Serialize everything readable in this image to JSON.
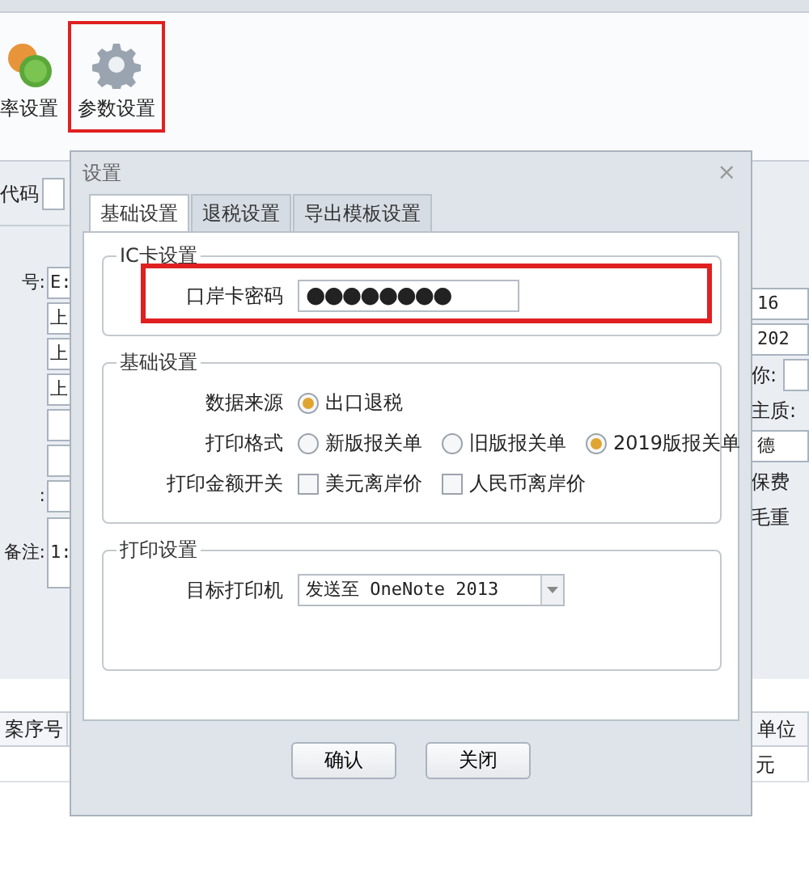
{
  "ribbon": {
    "buttons": [
      {
        "label": "率设置",
        "kind": "currency",
        "highlighted": false
      },
      {
        "label": "参数设置",
        "kind": "gear",
        "highlighted": true
      }
    ]
  },
  "left_panel": {
    "top_label": "代码",
    "rows": [
      {
        "label": "号:",
        "value": "E:"
      },
      {
        "value": "上"
      },
      {
        "value": "上"
      },
      {
        "value": "上"
      },
      {
        "kind": "field"
      },
      {
        "kind": "field"
      },
      {
        "label": ":"
      },
      {
        "label": "备注:",
        "value": "1:",
        "kind": "tall"
      }
    ]
  },
  "right_panel": {
    "rows": [
      {
        "kind": "field",
        "value": "16"
      },
      {
        "kind": "field",
        "value": "202"
      },
      {
        "kind": "label_field",
        "label": "你:"
      },
      {
        "kind": "label",
        "label": "主质:"
      },
      {
        "kind": "field",
        "value": "德"
      },
      {
        "kind": "label",
        "label": "保费"
      },
      {
        "kind": "label",
        "label": "毛重"
      }
    ]
  },
  "table": {
    "left_header": "案序号",
    "right_header": "单位",
    "right_cell": "元"
  },
  "dialog": {
    "title": "设置",
    "close": "×",
    "tabs": [
      {
        "label": "基础设置",
        "selected": true
      },
      {
        "label": "退税设置",
        "selected": false
      },
      {
        "label": "导出模板设置",
        "selected": false
      }
    ],
    "groups": [
      {
        "title": "IC卡设置",
        "highlighted": true,
        "rows": [
          {
            "label": "口岸卡密码",
            "kind": "password",
            "value": "●●●●●●●●"
          }
        ]
      },
      {
        "title": "基础设置",
        "highlighted": false,
        "rows": [
          {
            "label": "数据来源",
            "kind": "radio",
            "options": [
              {
                "label": "出口退税",
                "selected": true
              }
            ]
          },
          {
            "label": "打印格式",
            "kind": "radio",
            "options": [
              {
                "label": "新版报关单",
                "selected": false
              },
              {
                "label": "旧版报关单",
                "selected": false
              },
              {
                "label": "2019版报关单",
                "selected": true
              }
            ]
          },
          {
            "label": "打印金额开关",
            "kind": "checkbox",
            "options": [
              {
                "label": "美元离岸价",
                "checked": false
              },
              {
                "label": "人民币离岸价",
                "checked": false
              }
            ]
          }
        ]
      },
      {
        "title": "打印设置",
        "highlighted": false,
        "rows": [
          {
            "label": "目标打印机",
            "kind": "select",
            "value": "发送至 OneNote 2013"
          }
        ]
      }
    ],
    "buttons": [
      "确认",
      "关闭"
    ]
  }
}
